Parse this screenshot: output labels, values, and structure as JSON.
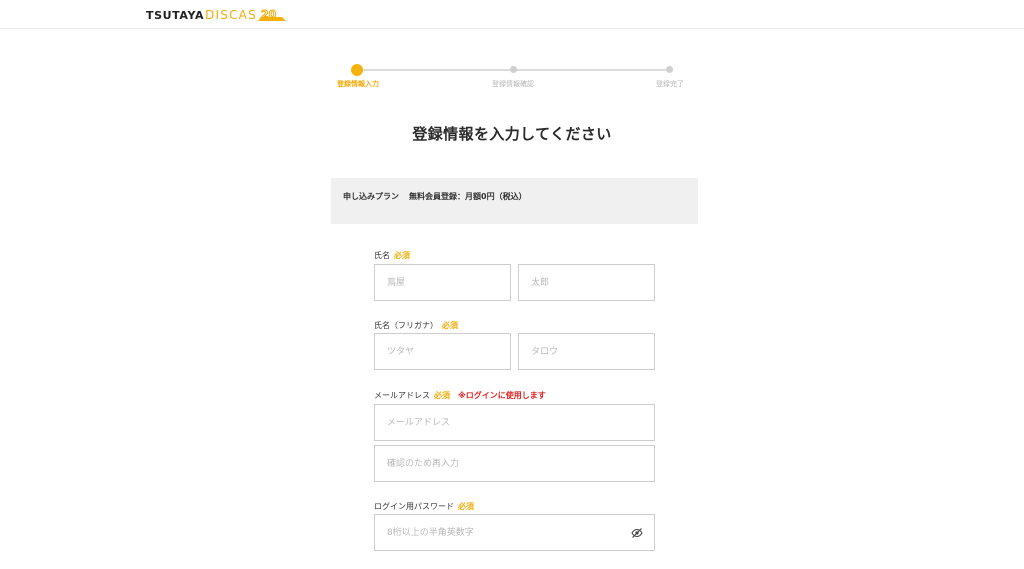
{
  "header": {
    "logo_primary": "TSUTAYA",
    "logo_secondary": "DISCAS",
    "logo_badge": "20"
  },
  "steps": [
    {
      "label": "登録情報入力",
      "state": "active"
    },
    {
      "label": "登録情報確認",
      "state": "inactive"
    },
    {
      "label": "登録完了",
      "state": "inactive"
    }
  ],
  "title": "登録情報を入力してください",
  "plan": {
    "label": "申し込みプラン",
    "value": "無料会員登録：月額0円（税込）"
  },
  "required_label": "必須",
  "fields": {
    "name": {
      "label": "氏名",
      "last_placeholder": "蔦屋",
      "first_placeholder": "太郎"
    },
    "kana": {
      "label": "氏名（フリガナ）",
      "last_placeholder": "ツタヤ",
      "first_placeholder": "タロウ"
    },
    "email": {
      "label": "メールアドレス",
      "note": "※ログインに使用します",
      "placeholder": "メールアドレス",
      "confirm_placeholder": "確認のため再入力"
    },
    "password": {
      "label": "ログイン用パスワード",
      "placeholder": "8桁以上の半角英数字"
    }
  },
  "colors": {
    "accent": "#f5b20c",
    "required": "#f2ac0c",
    "note": "#e02020",
    "plan_bg": "#f0f0f0"
  },
  "icons": {
    "password_toggle": "eye-slash-icon"
  }
}
